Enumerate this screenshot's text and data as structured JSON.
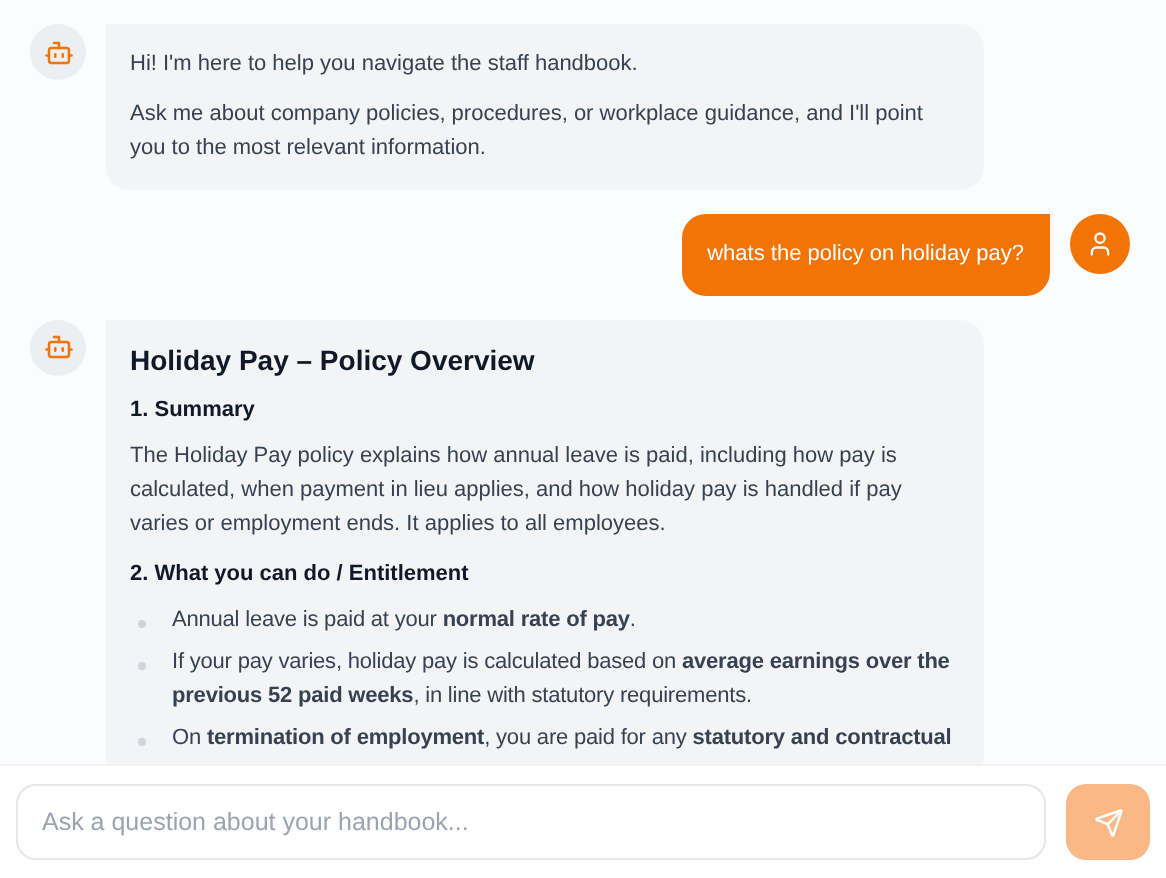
{
  "messages": [
    {
      "kind": "bot",
      "blocks": [
        {
          "kind": "paragraph",
          "text": "Hi! I'm here to help you navigate the staff handbook."
        },
        {
          "kind": "paragraph",
          "text": "Ask me about company policies, procedures, or workplace guidance, and I'll point you to the most relevant information."
        }
      ]
    },
    {
      "kind": "user",
      "text": "whats the policy on holiday pay?"
    },
    {
      "kind": "bot",
      "blocks": [
        {
          "kind": "title",
          "text": "Holiday Pay – Policy Overview"
        },
        {
          "kind": "heading",
          "text": "1. Summary"
        },
        {
          "kind": "paragraph",
          "text": "The Holiday Pay policy explains how annual leave is paid, including how pay is calculated, when payment in lieu applies, and how holiday pay is handled if pay varies or employment ends. It applies to all employees."
        },
        {
          "kind": "heading",
          "text": "2. What you can do / Entitlement"
        },
        {
          "kind": "list",
          "items": [
            "Annual leave is paid at your **normal rate of pay**.",
            "If your pay varies, holiday pay is calculated based on **average earnings over the previous 52 paid weeks**, in line with statutory requirements.",
            "On **termination of employment**, you are paid for any **statutory and contractual**"
          ]
        }
      ]
    }
  ],
  "composer": {
    "placeholder": "Ask a question about your handbook...",
    "send_disabled": true
  }
}
